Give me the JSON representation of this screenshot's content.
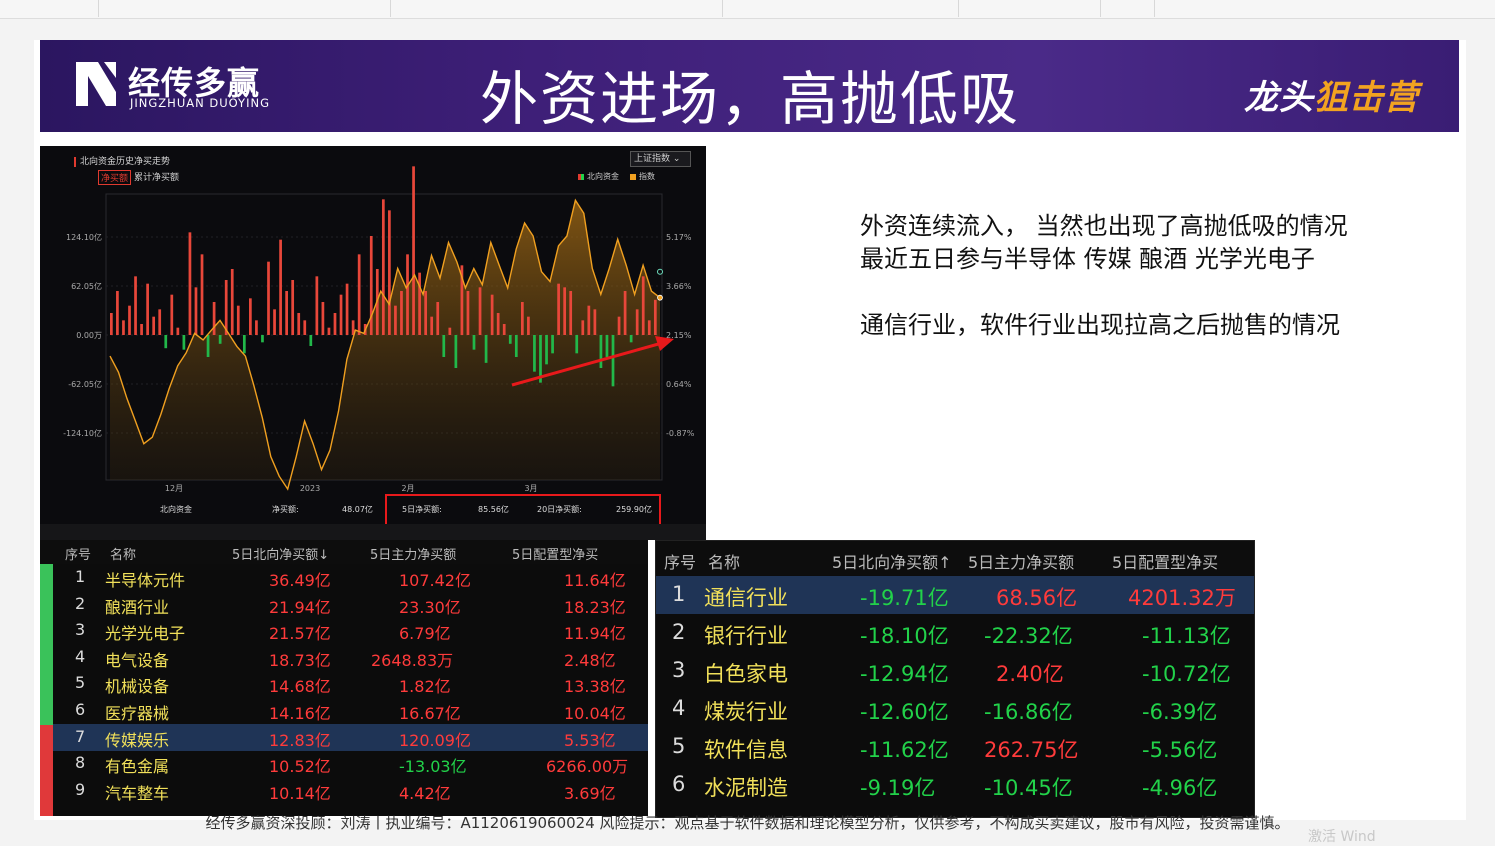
{
  "browser_tabs": [
    "",
    "",
    "",
    "",
    "",
    "",
    "",
    ""
  ],
  "banner": {
    "logo_cn": "经传多赢",
    "logo_en": "JINGZHUAN DUOYING",
    "title": "外资进场，高抛低吸",
    "brand_right_a": "龙头",
    "brand_right_b": "狙击营"
  },
  "chart_panel": {
    "title": "北向资金历史净买走势",
    "tab_net": "净买额",
    "tab_cum": "累计净买额",
    "select": "上证指数",
    "legend_north": "北向资金",
    "legend_index": "指数",
    "footer": {
      "label": "北向资金",
      "net_label": "净买额:",
      "net_value": "48.07亿",
      "d5_label": "5日净买额:",
      "d5_value": "85.56亿",
      "d20_label": "20日净买额:",
      "d20_value": "259.90亿"
    }
  },
  "chart_data": {
    "type": "bar",
    "title": "北向资金历史净买走势",
    "series": [
      {
        "name": "北向资金",
        "values": [
          30,
          60,
          20,
          40,
          80,
          15,
          70,
          25,
          35,
          -18,
          55,
          10,
          -20,
          140,
          65,
          110,
          -30,
          45,
          -12,
          75,
          90,
          40,
          -25,
          50,
          20,
          -10,
          100,
          35,
          130,
          60,
          75,
          30,
          20,
          -15,
          80,
          45,
          10,
          30,
          55,
          70,
          20,
          110,
          15,
          135,
          90,
          185,
          170,
          40,
          60,
          110,
          230,
          85,
          60,
          25,
          45,
          -30,
          10,
          -45,
          95,
          60,
          -20,
          65,
          -38,
          55,
          30,
          15,
          -12,
          -30,
          45,
          25,
          -50,
          -65,
          -40,
          -25,
          70,
          65,
          60,
          -25,
          20,
          40,
          35,
          -45,
          -30,
          -70,
          25,
          60,
          -10,
          35,
          80,
          20,
          48
        ]
      },
      {
        "name": "指数",
        "values": [
          1.5,
          1.0,
          0.2,
          -0.5,
          -1.2,
          -1.0,
          -0.3,
          0.5,
          1.2,
          1.6,
          2.2,
          2.0,
          2.3,
          2.6,
          2.2,
          1.8,
          1.5,
          0.6,
          -0.4,
          -1.6,
          -2.2,
          -2.6,
          -1.6,
          -0.5,
          -1.2,
          -2.0,
          -1.4,
          -0.2,
          1.4,
          2.3,
          2.2,
          2.8,
          3.5,
          3.1,
          4.2,
          3.6,
          4.0,
          3.4,
          4.6,
          3.9,
          5.0,
          4.4,
          3.6,
          4.2,
          3.7,
          5.0,
          4.3,
          3.6,
          4.8,
          5.6,
          5.2,
          4.1,
          3.8,
          4.9,
          5.2,
          6.3,
          5.9,
          4.2,
          3.4,
          4.2,
          5.1,
          4.3,
          3.4,
          4.3,
          3.5,
          3.3
        ]
      }
    ],
    "x_ticks": [
      "12月",
      "2023",
      "2月",
      "3月"
    ],
    "y_left_ticks": [
      "124.10亿",
      "62.05亿",
      "0.00万",
      "-62.05亿",
      "-124.10亿"
    ],
    "y_right_ticks": [
      "5.17%",
      "3.66%",
      "2.15%",
      "0.64%",
      "-0.87%"
    ],
    "ylim": [
      -190,
      200
    ],
    "grid": true
  },
  "table_left": {
    "headers": [
      "序号",
      "名称",
      "5日北向净买额↓",
      "5日主力净买额",
      "5日配置型净买"
    ],
    "rows": [
      {
        "no": "1",
        "name": "半导体元件",
        "north": "36.49亿",
        "main": "107.42亿",
        "cfg": "11.64亿",
        "main_up": true
      },
      {
        "no": "2",
        "name": "酿酒行业",
        "north": "21.94亿",
        "main": "23.30亿",
        "cfg": "18.23亿",
        "main_up": true
      },
      {
        "no": "3",
        "name": "光学光电子",
        "north": "21.57亿",
        "main": "6.79亿",
        "cfg": "11.94亿",
        "main_up": true
      },
      {
        "no": "4",
        "name": "电气设备",
        "north": "18.73亿",
        "main": "2648.83万",
        "cfg": "2.48亿",
        "main_up": true
      },
      {
        "no": "5",
        "name": "机械设备",
        "north": "14.68亿",
        "main": "1.82亿",
        "cfg": "13.38亿",
        "main_up": true
      },
      {
        "no": "6",
        "name": "医疗器械",
        "north": "14.16亿",
        "main": "16.67亿",
        "cfg": "10.04亿",
        "main_up": true
      },
      {
        "no": "7",
        "name": "传媒娱乐",
        "north": "12.83亿",
        "main": "120.09亿",
        "cfg": "5.53亿",
        "main_up": true
      },
      {
        "no": "8",
        "name": "有色金属",
        "north": "10.52亿",
        "main": "-13.03亿",
        "cfg": "6266.00万",
        "main_up": false
      },
      {
        "no": "9",
        "name": "汽车整车",
        "north": "10.14亿",
        "main": "4.42亿",
        "cfg": "3.69亿",
        "main_up": true
      }
    ]
  },
  "table_right": {
    "headers": [
      "序号",
      "名称",
      "5日北向净买额↑",
      "5日主力净买额",
      "5日配置型净买"
    ],
    "rows": [
      {
        "no": "1",
        "name": "通信行业",
        "north": "-19.71亿",
        "main": "68.56亿",
        "cfg": "4201.32万",
        "main_up": true,
        "cfg_up": true
      },
      {
        "no": "2",
        "name": "银行行业",
        "north": "-18.10亿",
        "main": "-22.32亿",
        "cfg": "-11.13亿",
        "main_up": false,
        "cfg_up": false
      },
      {
        "no": "3",
        "name": "白色家电",
        "north": "-12.94亿",
        "main": "2.40亿",
        "cfg": "-10.72亿",
        "main_up": true,
        "cfg_up": false
      },
      {
        "no": "4",
        "name": "煤炭行业",
        "north": "-12.60亿",
        "main": "-16.86亿",
        "cfg": "-6.39亿",
        "main_up": false,
        "cfg_up": false
      },
      {
        "no": "5",
        "name": "软件信息",
        "north": "-11.62亿",
        "main": "262.75亿",
        "cfg": "-5.56亿",
        "main_up": true,
        "cfg_up": false
      },
      {
        "no": "6",
        "name": "水泥制造",
        "north": "-9.19亿",
        "main": "-10.45亿",
        "cfg": "-4.96亿",
        "main_up": false,
        "cfg_up": false
      }
    ]
  },
  "notes": {
    "line1": "外资连续流入， 当然也出现了高抛低吸的情况",
    "line2": "最近五日参与半导体  传媒 酿酒  光学光电子",
    "line3": "通信行业，软件行业出现拉高之后抛售的情况"
  },
  "footer_text": "经传多赢资深投顾：刘涛丨执业编号：A1120619060024   风险提示：观点基于软件数据和理论模型分析，仅供参考，不构成买卖建议，股市有风险，投资需谨慎。",
  "watermark": "激活 Wind",
  "colors": {
    "up": "#ff3b3b",
    "down": "#22d24a",
    "index_line": "#f0a020",
    "banner": "#3e1f78"
  }
}
